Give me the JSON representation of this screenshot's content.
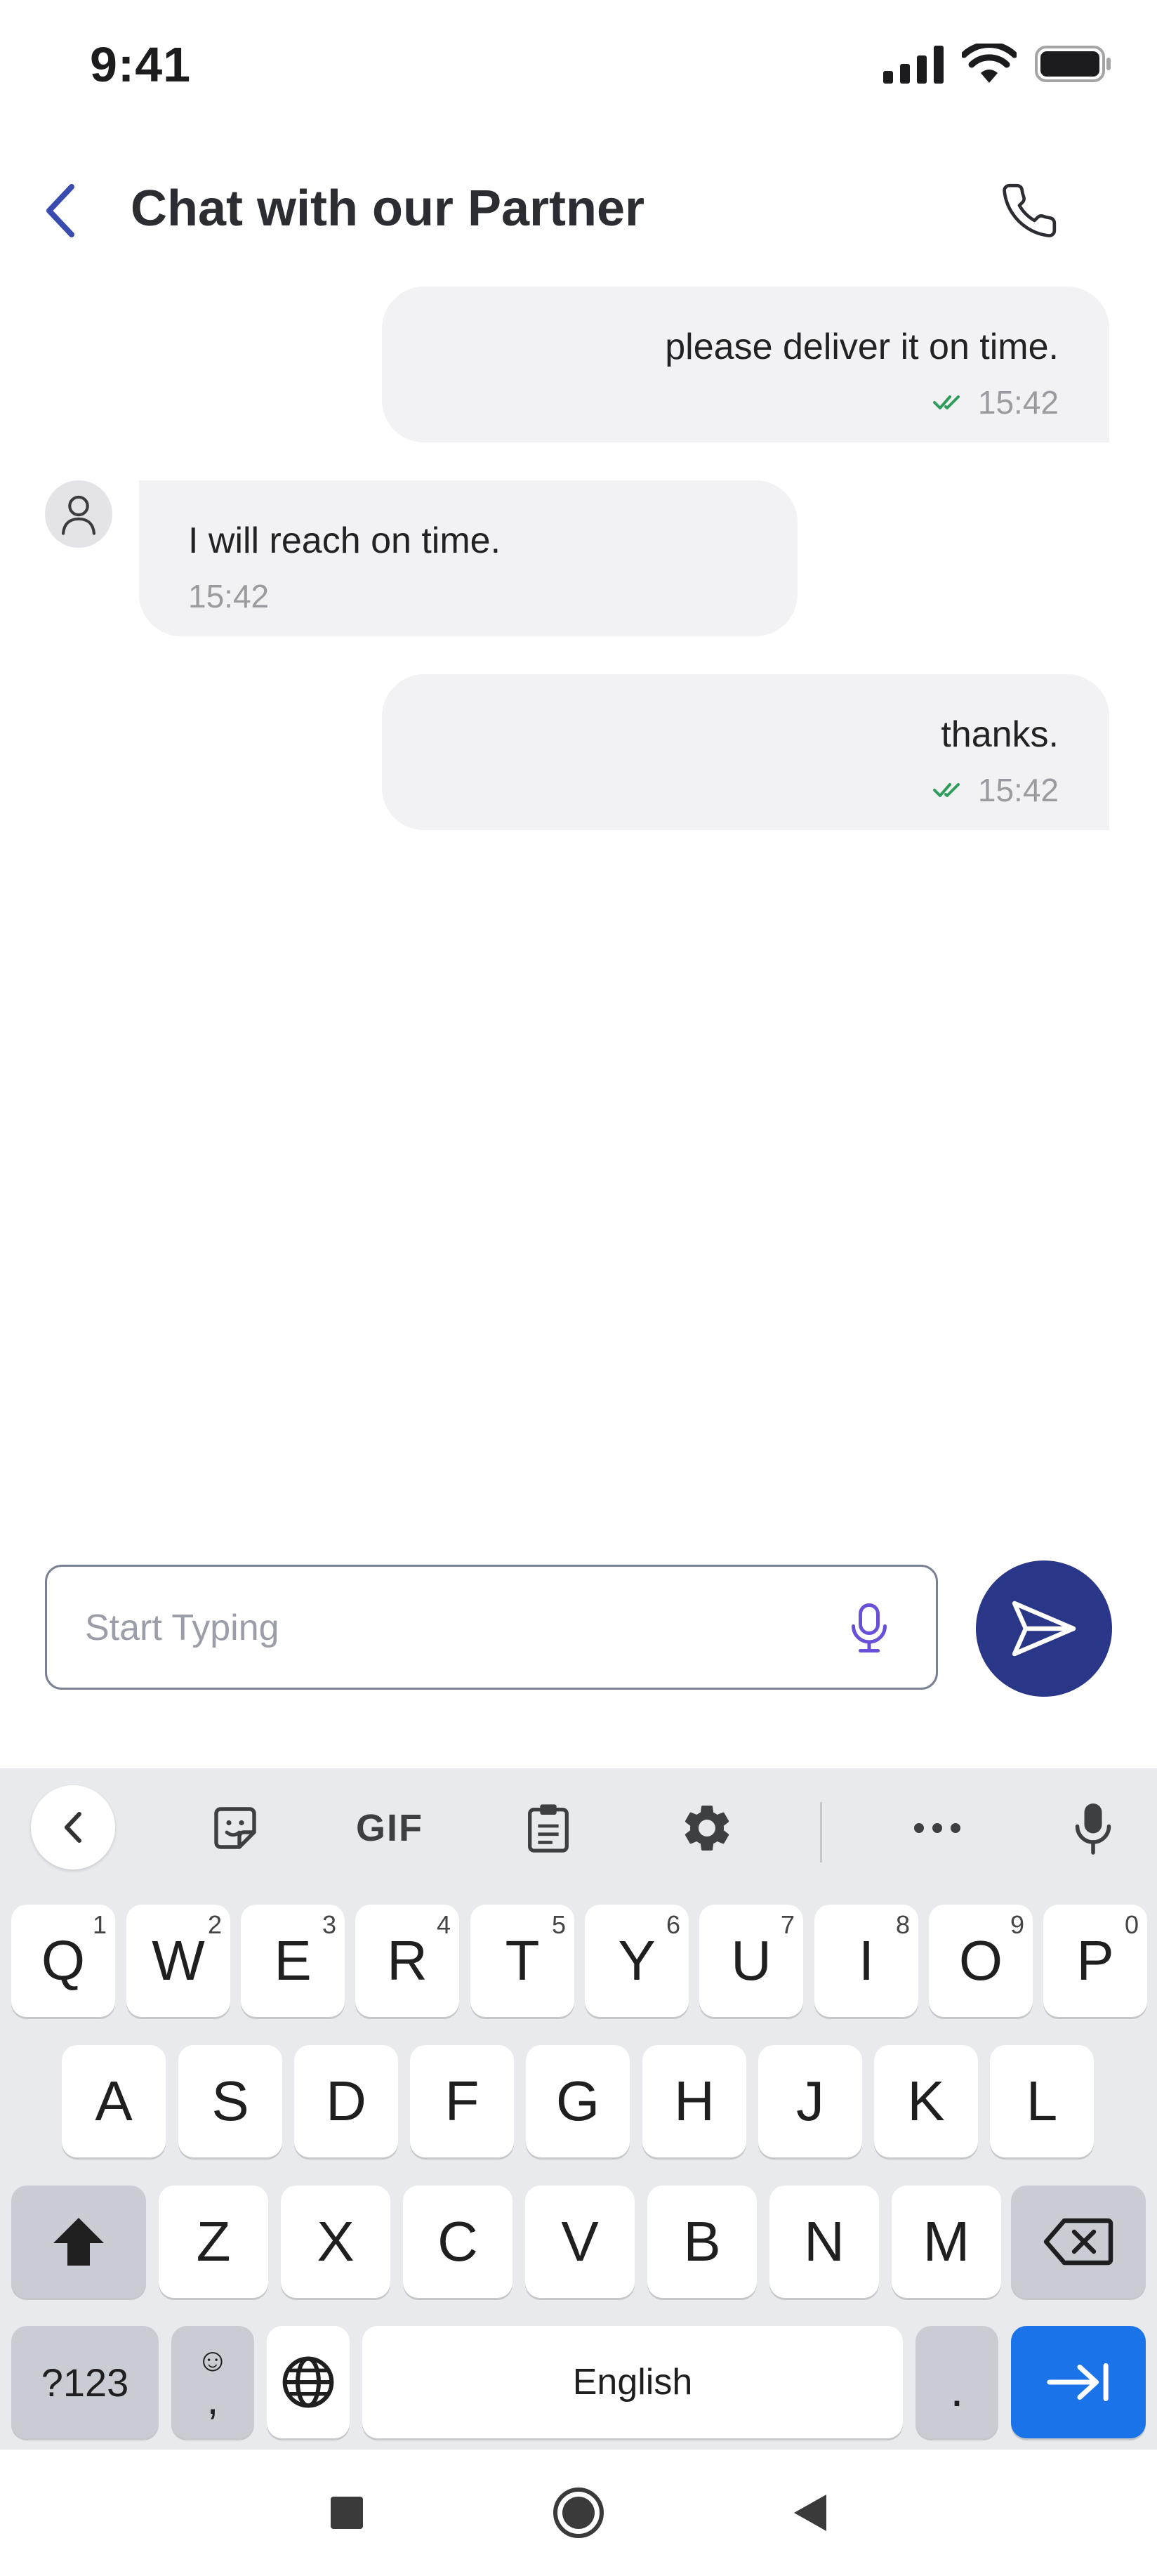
{
  "status_bar": {
    "time": "9:41"
  },
  "header": {
    "title": "Chat with our Partner"
  },
  "messages": [
    {
      "direction": "out",
      "text": "please deliver it on time.",
      "time": "15:42",
      "read": true
    },
    {
      "direction": "in",
      "text": "I will reach on time.",
      "time": "15:42"
    },
    {
      "direction": "out",
      "text": "thanks.",
      "time": "15:42",
      "read": true
    }
  ],
  "composer": {
    "placeholder": "Start Typing",
    "value": ""
  },
  "keyboard": {
    "toolbar": [
      "collapse",
      "sticker",
      "GIF",
      "clipboard",
      "settings",
      "more",
      "voice"
    ],
    "gif_label": "GIF",
    "row1": [
      {
        "k": "Q",
        "h": "1"
      },
      {
        "k": "W",
        "h": "2"
      },
      {
        "k": "E",
        "h": "3"
      },
      {
        "k": "R",
        "h": "4"
      },
      {
        "k": "T",
        "h": "5"
      },
      {
        "k": "Y",
        "h": "6"
      },
      {
        "k": "U",
        "h": "7"
      },
      {
        "k": "I",
        "h": "8"
      },
      {
        "k": "O",
        "h": "9"
      },
      {
        "k": "P",
        "h": "0"
      }
    ],
    "row2": [
      "A",
      "S",
      "D",
      "F",
      "G",
      "H",
      "J",
      "K",
      "L"
    ],
    "row3": [
      "Z",
      "X",
      "C",
      "V",
      "B",
      "N",
      "M"
    ],
    "symbols_label": "?123",
    "emoji_comma": {
      "top": "☺",
      "bottom": ","
    },
    "space_label": "English",
    "period_label": ".",
    "accent_color": "#1a73e8"
  },
  "colors": {
    "primary": "#2a3687",
    "back_arrow": "#3a4bb0",
    "bubble_bg": "#f2f2f5",
    "read_check": "#2e9c5a",
    "mic": "#6a4fd8"
  }
}
